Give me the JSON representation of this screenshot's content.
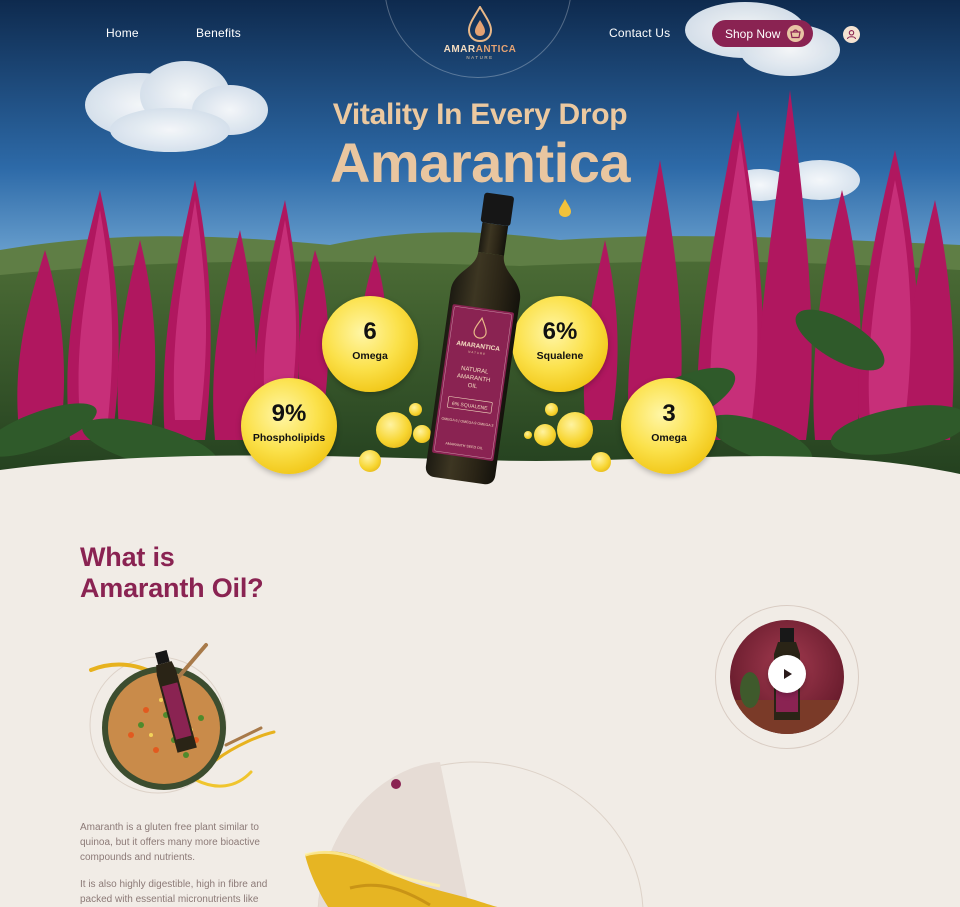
{
  "nav": {
    "home": "Home",
    "benefits": "Benefits",
    "contact": "Contact Us",
    "shop": "Shop Now",
    "shop_icon": "basket-icon",
    "user_icon": "user-icon"
  },
  "logo": {
    "name_part1": "AMAR",
    "name_part2": "ANTICA",
    "sub": "NATURE"
  },
  "hero": {
    "tagline": "Vitality In Every Drop",
    "title": "Amarantica"
  },
  "bottle": {
    "brand": "AMARANTICA",
    "brand_sub": "NATURE",
    "line1": "NATURAL",
    "line2": "AMARANTH",
    "line3": "OIL",
    "badge": "6% SQUALENE",
    "small": "OMEGA 6 | OMEGA 9 OMEGA 3",
    "foot": "AMARANTH SEED OIL"
  },
  "stats": [
    {
      "value": "6",
      "label": "Omega"
    },
    {
      "value": "6%",
      "label": "Squalene"
    },
    {
      "value": "9%",
      "label": "Phospholipids"
    },
    {
      "value": "3",
      "label": "Omega"
    }
  ],
  "section": {
    "title_line1": "What is",
    "title_line2": "Amaranth Oil?",
    "para1": "Amaranth is a gluten free plant similar to quinoa, but it offers many more bioactive compounds and nutrients.",
    "para2": "It is also highly digestible, high in fibre and packed with essential micronutrients like",
    "video_icon": "play-icon"
  },
  "colors": {
    "brand": "#8a2352",
    "gold": "#e9c6a0",
    "background": "#f1ece6"
  }
}
